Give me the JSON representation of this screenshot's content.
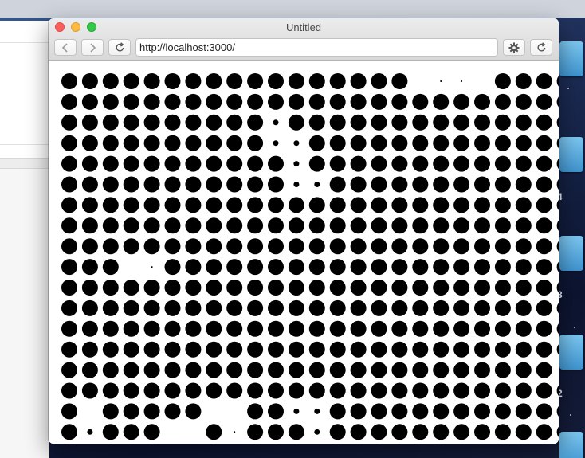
{
  "window": {
    "title": "Untitled",
    "address": "http://localhost:3000/"
  },
  "desktop": {
    "labels": [
      "4",
      "3",
      "2"
    ]
  },
  "content": {
    "description_free": true,
    "grid": {
      "columns": 25,
      "rows": 18,
      "dot_color": "#000000",
      "background": "#ffffff",
      "large_radius": 10,
      "small_radius": 3.5,
      "tiny_radius": 1,
      "small_dots": [
        [
          2,
          10
        ],
        [
          3,
          10
        ],
        [
          3,
          11
        ],
        [
          4,
          11
        ],
        [
          5,
          11
        ],
        [
          5,
          12
        ],
        [
          17,
          1
        ],
        [
          16,
          11
        ],
        [
          16,
          12
        ],
        [
          17,
          12
        ],
        [
          18,
          12
        ],
        [
          18,
          13
        ],
        [
          18,
          14
        ],
        [
          18,
          15
        ],
        [
          19,
          7
        ],
        [
          19,
          8
        ]
      ],
      "tiny_dots": [
        [
          0,
          18
        ],
        [
          0,
          19
        ],
        [
          9,
          4
        ],
        [
          14,
          24
        ],
        [
          17,
          8
        ]
      ],
      "missing_dots": [
        [
          0,
          17
        ],
        [
          0,
          20
        ],
        [
          9,
          3
        ],
        [
          16,
          1
        ],
        [
          16,
          7
        ],
        [
          16,
          8
        ],
        [
          17,
          5
        ],
        [
          17,
          6
        ]
      ]
    }
  }
}
